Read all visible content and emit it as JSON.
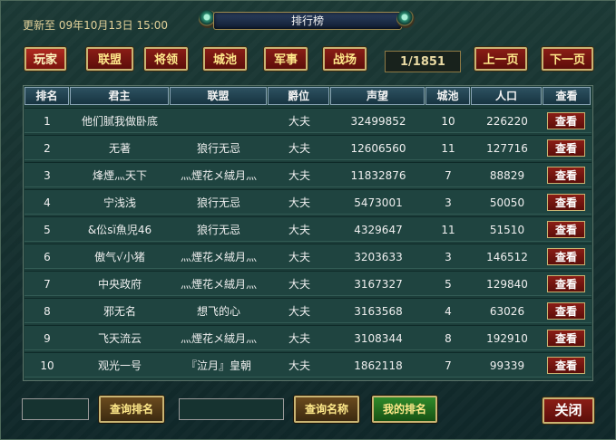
{
  "header": {
    "update_time": "更新至 09年10月13日 15:00",
    "title": "排行榜"
  },
  "tabs": [
    {
      "label": "玩家",
      "active": true
    },
    {
      "label": "联盟",
      "active": false
    },
    {
      "label": "将领",
      "active": false
    },
    {
      "label": "城池",
      "active": false
    },
    {
      "label": "军事",
      "active": false
    },
    {
      "label": "战场",
      "active": false
    }
  ],
  "pagination": {
    "indicator": "1/1851",
    "prev_label": "上一页",
    "next_label": "下一页"
  },
  "table": {
    "columns": [
      "排名",
      "君主",
      "联盟",
      "爵位",
      "声望",
      "城池",
      "人口",
      "查看"
    ],
    "rows": [
      {
        "rank": "1",
        "lord": "他们腻我做卧底",
        "alliance": "",
        "title": "大夫",
        "prestige": "32499852",
        "cities": "10",
        "population": "226220",
        "action": "查看"
      },
      {
        "rank": "2",
        "lord": "无著",
        "alliance": "狼行无忌",
        "title": "大夫",
        "prestige": "12606560",
        "cities": "11",
        "population": "127716",
        "action": "查看"
      },
      {
        "rank": "3",
        "lord": "烽煙灬天下",
        "alliance": "灬煙花メ絨月灬",
        "title": "大夫",
        "prestige": "11832876",
        "cities": "7",
        "population": "88829",
        "action": "查看"
      },
      {
        "rank": "4",
        "lord": "宁浅浅",
        "alliance": "狼行无忌",
        "title": "大夫",
        "prestige": "5473001",
        "cities": "3",
        "population": "50050",
        "action": "查看"
      },
      {
        "rank": "5",
        "lord": "&伀ѕї魚児46",
        "alliance": "狼行无忌",
        "title": "大夫",
        "prestige": "4329647",
        "cities": "11",
        "population": "51510",
        "action": "查看"
      },
      {
        "rank": "6",
        "lord": "傲气√小猪",
        "alliance": "灬煙花メ絨月灬",
        "title": "大夫",
        "prestige": "3203633",
        "cities": "3",
        "population": "146512",
        "action": "查看"
      },
      {
        "rank": "7",
        "lord": "中央政府",
        "alliance": "灬煙花メ絨月灬",
        "title": "大夫",
        "prestige": "3167327",
        "cities": "5",
        "population": "129840",
        "action": "查看"
      },
      {
        "rank": "8",
        "lord": "邪无名",
        "alliance": "想飞的心",
        "title": "大夫",
        "prestige": "3163568",
        "cities": "4",
        "population": "63026",
        "action": "查看"
      },
      {
        "rank": "9",
        "lord": "飞天流云",
        "alliance": "灬煙花メ絨月灬",
        "title": "大夫",
        "prestige": "3108344",
        "cities": "8",
        "population": "192910",
        "action": "查看"
      },
      {
        "rank": "10",
        "lord": "观光一号",
        "alliance": "『泣月』皇朝",
        "title": "大夫",
        "prestige": "1862118",
        "cities": "7",
        "population": "99339",
        "action": "查看"
      }
    ]
  },
  "footer": {
    "rank_input_value": "",
    "rank_query_label": "查询排名",
    "name_input_value": "",
    "name_query_label": "查询名称",
    "my_rank_label": "我的排名",
    "close_label": "关闭"
  }
}
